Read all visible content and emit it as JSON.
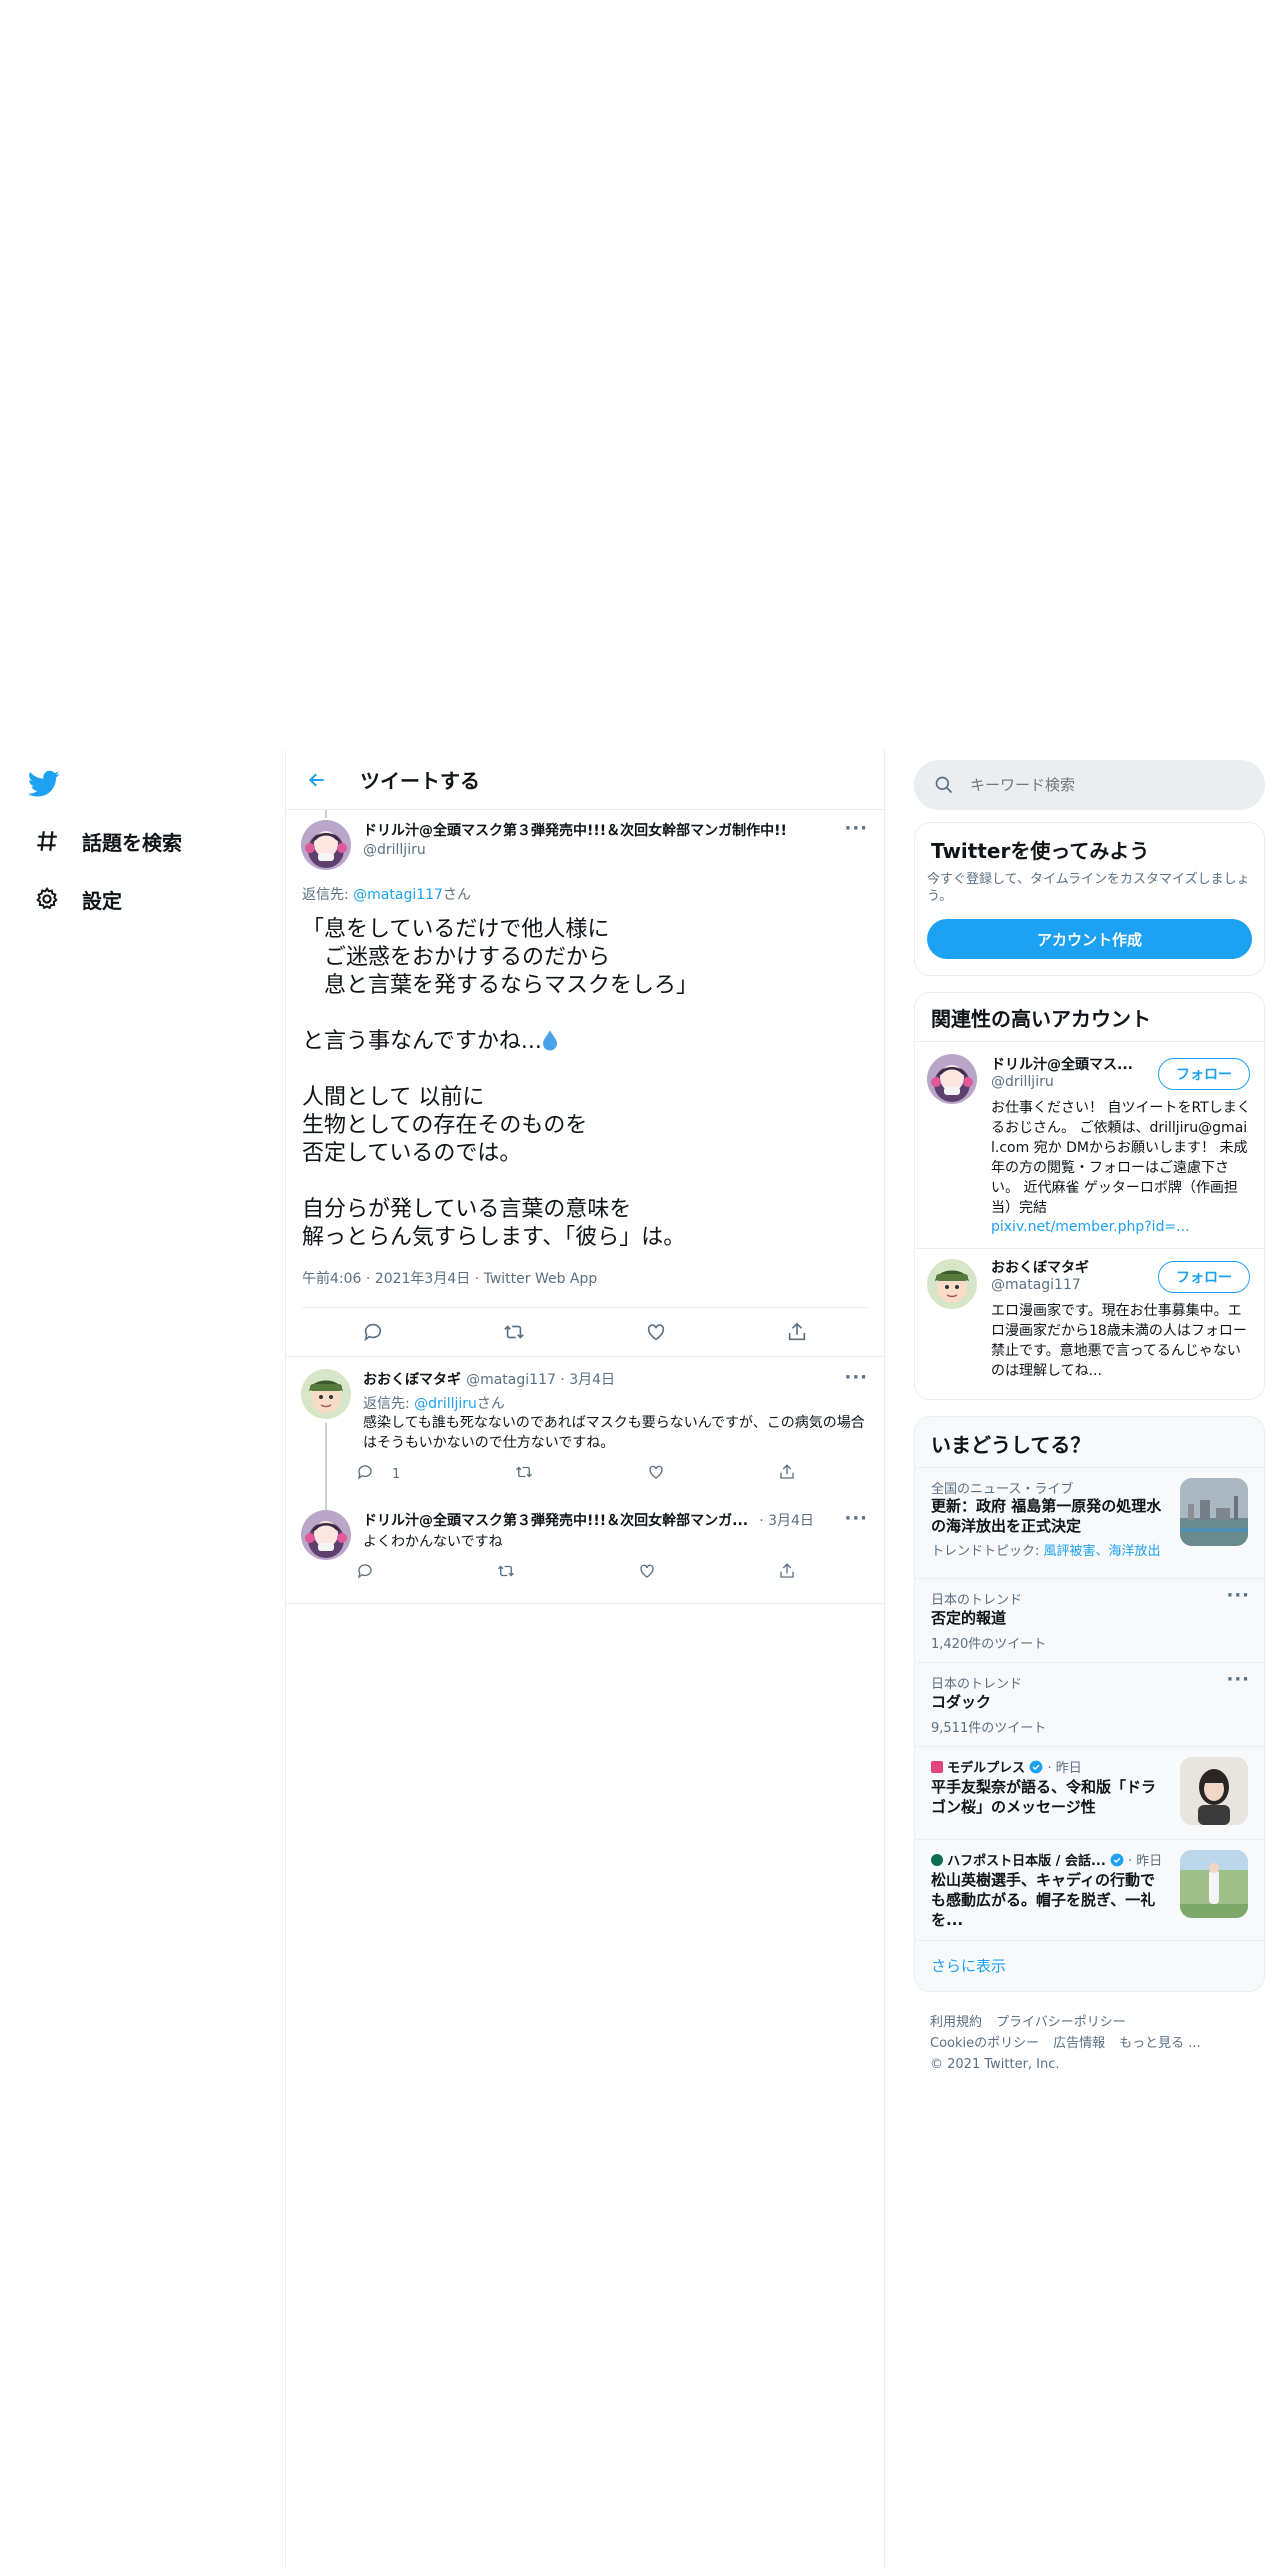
{
  "nav": {
    "items": [
      {
        "label": "話題を検索",
        "icon": "hashtag-icon"
      },
      {
        "label": "設定",
        "icon": "gear-icon"
      }
    ]
  },
  "header": {
    "title": "ツイートする"
  },
  "main_tweet": {
    "author_name": "ドリル汁@全頭マスク第３弾発売中!!!＆次回女幹部マンガ制作中!!",
    "author_handle": "@drilljiru",
    "reply_prefix": "返信先: ",
    "reply_to": "@matagi117",
    "reply_suffix": "さん",
    "text_1": "「息をしているだけで他人様に\n　ご迷惑をおかけするのだから\n　息と言葉を発するならマスクをしろ」\n\nと言う事なんですかね...",
    "text_2": "\n\n人間として 以前に\n生物としての存在そのものを\n否定しているのでは。\n\n自分らが発している言葉の意味を\n解っとらん気すらします、「彼ら」は。",
    "meta": "午前4:06 · 2021年3月4日 · Twitter Web App"
  },
  "replies": [
    {
      "name": "おおくぼマタギ",
      "handle_date": "@matagi117 · 3月4日",
      "reply_prefix": "返信先: ",
      "reply_to": "@drilljiru",
      "reply_suffix": "さん",
      "text": "感染しても誰も死なないのであればマスクも要らないんですが、この病気の場合はそうもいかないので仕方ないですね。",
      "reply_count": "1"
    },
    {
      "name": "ドリル汁@全頭マスク第３弾発売中!!!＆次回女幹部マンガ...",
      "handle_date": "· 3月4日",
      "text": "よくわかんないですね"
    }
  ],
  "search": {
    "placeholder": "キーワード検索"
  },
  "signup_card": {
    "title": "Twitterを使ってみよう",
    "subtitle": "今すぐ登録して、タイムラインをカスタマイズしましょう。",
    "button": "アカウント作成"
  },
  "related": {
    "title": "関連性の高いアカウント",
    "follow_label": "フォロー",
    "accounts": [
      {
        "name": "ドリル汁@全頭マス...",
        "handle": "@drilljiru",
        "bio": "お仕事ください！ 自ツイートをRTしまくるおじさん。 ご依頼は、drilljiru@gmail.com 宛か DMからお願いします！ 未成年の方の閲覧・フォローはご遠慮下さい。 近代麻雀 ゲッターロボ牌（作画担当）完結",
        "link": "pixiv.net/member.php?id=..."
      },
      {
        "name": "おおくぼマタギ",
        "handle": "@matagi117",
        "bio": "エロ漫画家です。現在お仕事募集中。エロ漫画家だから18歳未満の人はフォロー禁止です。意地悪で言ってるんじゃないのは理解してね..."
      }
    ]
  },
  "trends": {
    "title": "いまどうしてる？",
    "items": [
      {
        "context": "全国のニュース・ライブ",
        "title": "更新：政府 福島第一原発の処理水の海洋放出を正式決定",
        "topic_prefix": "トレンドトピック: ",
        "topic_links": "風評被害、海洋放出"
      },
      {
        "context": "日本のトレンド",
        "title": "否定的報道",
        "count": "1,420件のツイート"
      },
      {
        "context": "日本のトレンド",
        "title": "コダック",
        "count": "9,511件のツイート"
      },
      {
        "source": "モデルプレス",
        "time": "· 昨日",
        "title": "平手友梨奈が語る、令和版「ドラゴン桜」のメッセージ性"
      },
      {
        "source": "ハフポスト日本版 / 会話...",
        "time": "· 昨日",
        "title": "松山英樹選手、キャディの行動でも感動広がる。帽子を脱ぎ、一礼を..."
      }
    ],
    "show_more": "さらに表示"
  },
  "footer": {
    "links_1": [
      "利用規約",
      "プライバシーポリシー"
    ],
    "links_2": [
      "Cookieのポリシー",
      "広告情報",
      "もっと見る ..."
    ],
    "copyright": "© 2021 Twitter, Inc."
  },
  "colors": {
    "accent": "#1da1f2",
    "text": "#0f1419",
    "muted": "#5b7083",
    "border": "#ebeef0"
  }
}
